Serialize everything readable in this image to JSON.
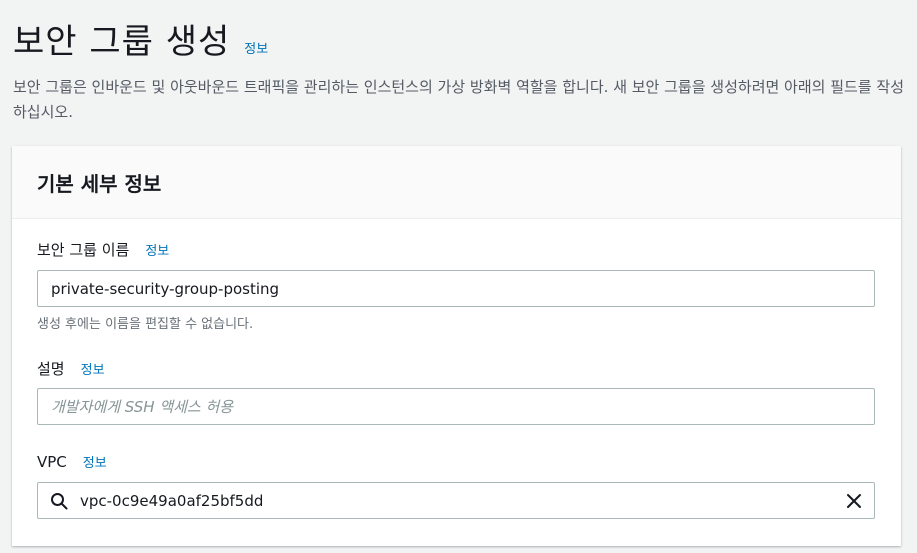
{
  "header": {
    "title": "보안 그룹 생성",
    "info": "정보",
    "description": "보안 그룹은 인바운드 및 아웃바운드 트래픽을 관리하는 인스턴스의 가상 방화벽 역할을 합니다. 새 보안 그룹을 생성하려면 아래의 필드를 작성하십시오."
  },
  "basic_details": {
    "title": "기본 세부 정보",
    "name_field": {
      "label": "보안 그룹 이름",
      "info": "정보",
      "value": "private-security-group-posting",
      "constraint": "생성 후에는 이름을 편집할 수 없습니다."
    },
    "description_field": {
      "label": "설명",
      "info": "정보",
      "value": "",
      "placeholder": "개발자에게 SSH 액세스 허용"
    },
    "vpc_field": {
      "label": "VPC",
      "info": "정보",
      "value": "vpc-0c9e49a0af25bf5dd"
    }
  },
  "icons": {
    "search": "search-icon",
    "clear": "close-icon"
  },
  "colors": {
    "link": "#0073bb",
    "background": "#f2f3f3",
    "border": "#aab7b8"
  }
}
